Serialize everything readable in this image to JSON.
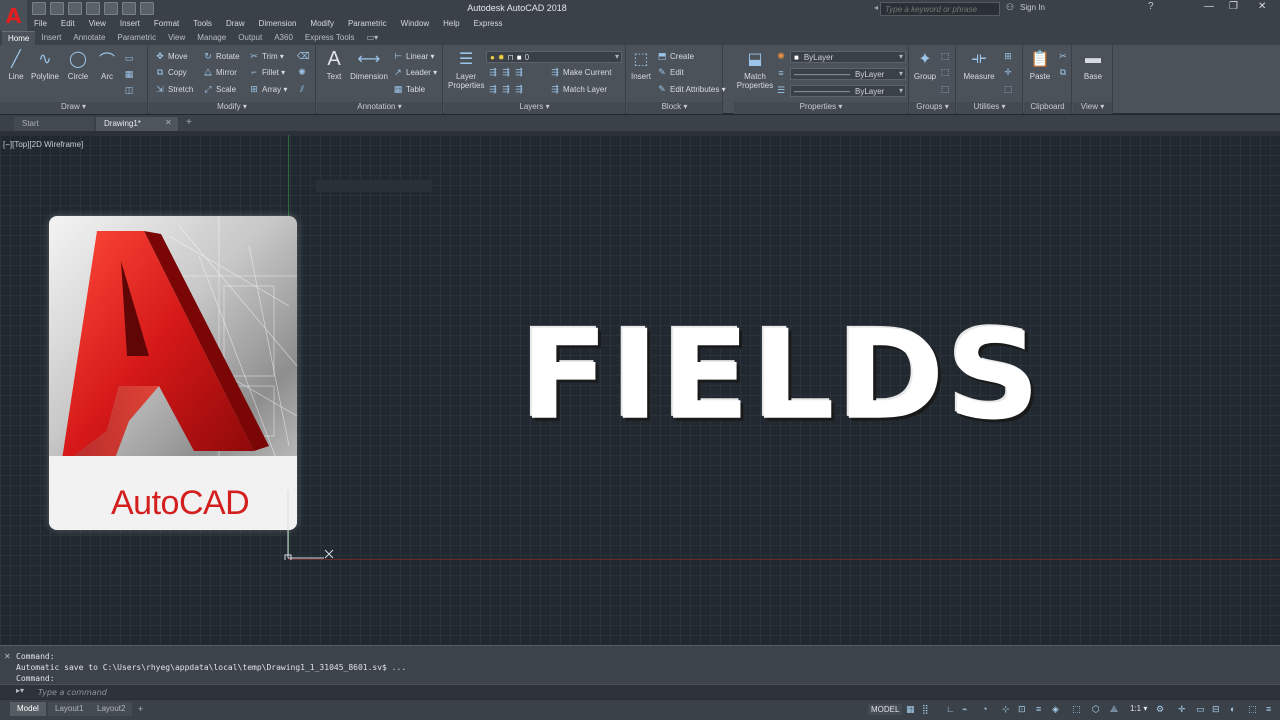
{
  "window": {
    "title": "Autodesk AutoCAD 2018",
    "logo_letter": "A",
    "search_placeholder": "Type a keyword or phrase",
    "sign_in": "Sign In",
    "controls": [
      "—",
      "❐",
      "✕"
    ]
  },
  "menu": [
    "File",
    "Edit",
    "View",
    "Insert",
    "Format",
    "Tools",
    "Draw",
    "Dimension",
    "Modify",
    "Parametric",
    "Window",
    "Help",
    "Express"
  ],
  "ribbon_tabs": [
    "Home",
    "Insert",
    "Annotate",
    "Parametric",
    "View",
    "Manage",
    "Output",
    "A360",
    "Express Tools"
  ],
  "ribbon": {
    "draw": {
      "title": "Draw ▾",
      "line": "Line",
      "polyline": "Polyline",
      "circle": "Circle",
      "arc": "Arc"
    },
    "modify": {
      "title": "Modify ▾",
      "move": "Move",
      "rotate": "Rotate",
      "trim": "Trim ▾",
      "copy": "Copy",
      "mirror": "Mirror",
      "fillet": "Fillet ▾",
      "stretch": "Stretch",
      "scale": "Scale",
      "array": "Array ▾"
    },
    "annotation": {
      "title": "Annotation ▾",
      "text": "Text",
      "dimension": "Dimension",
      "linear": "Linear ▾",
      "leader": "Leader ▾",
      "table": "Table"
    },
    "layers": {
      "title": "Layers ▾",
      "layer_properties": "Layer Properties",
      "layer_combo": "0",
      "make_current": "Make Current",
      "match_layer": "Match Layer"
    },
    "block": {
      "title": "Block ▾",
      "insert": "Insert",
      "create": "Create",
      "edit": "Edit",
      "edit_attributes": "Edit Attributes ▾"
    },
    "properties": {
      "title": "Properties ▾",
      "match_properties": "Match Properties",
      "color": "ByLayer",
      "linetype": "ByLayer",
      "lineweight": "ByLayer"
    },
    "groups": {
      "title": "Groups ▾",
      "group": "Group"
    },
    "utilities": {
      "title": "Utilities ▾",
      "measure": "Measure"
    },
    "clipboard": {
      "title": "Clipboard",
      "paste": "Paste"
    },
    "view": {
      "title": "View ▾",
      "base": "Base"
    }
  },
  "doc_tabs": {
    "start": "Start",
    "drawing": "Drawing1*",
    "close": "✕",
    "add": "+"
  },
  "viewport_label": "[−][Top][2D Wireframe]",
  "headline": "FIELDS",
  "logo_word": "AutoCAD",
  "command": {
    "history": [
      "Command:",
      "Automatic save to C:\\Users\\rhyeg\\appdata\\local\\temp\\Drawing1_1_31045_8601.sv$ ...",
      "Command:"
    ],
    "placeholder": "Type a command"
  },
  "status": {
    "layouts": [
      "Model",
      "Layout1",
      "Layout2"
    ],
    "add": "+",
    "mode": "MODEL",
    "scale": "1:1 ▾"
  }
}
